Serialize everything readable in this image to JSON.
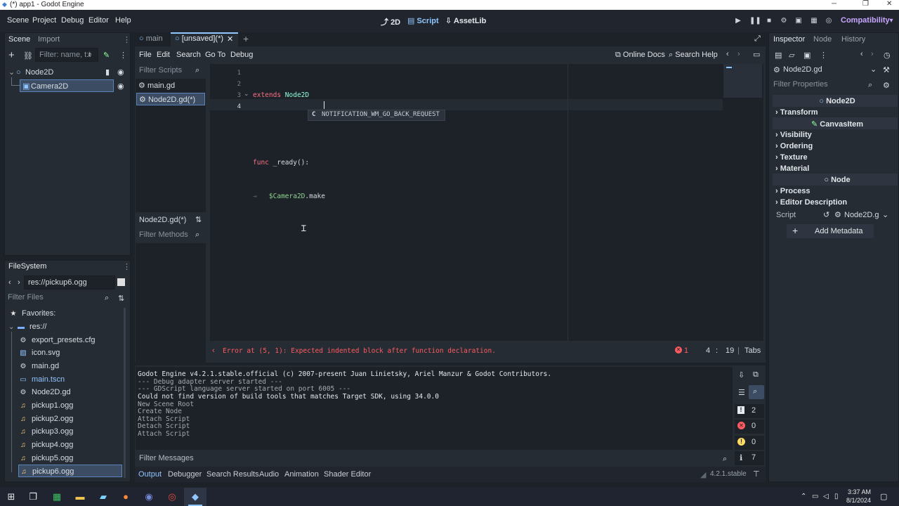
{
  "window": {
    "title": "(*) app1 - Godot Engine"
  },
  "menubar": {
    "menus": [
      "Scene",
      "Project",
      "Debug",
      "Editor",
      "Help"
    ],
    "workspaces": [
      "2D",
      "Script",
      "AssetLib"
    ],
    "renderer": "Compatibility"
  },
  "scene_dock": {
    "tabs": [
      "Scene",
      "Import"
    ],
    "filter_placeholder": "Filter: name, t:t",
    "nodes": [
      "Node2D",
      "Camera2D"
    ]
  },
  "filesystem": {
    "title": "FileSystem",
    "path": "res://pickup6.ogg",
    "filter_placeholder": "Filter Files",
    "favorites": "Favorites:",
    "root": "res://",
    "files": [
      "export_presets.cfg",
      "icon.svg",
      "main.gd",
      "main.tscn",
      "Node2D.gd",
      "pickup1.ogg",
      "pickup2.ogg",
      "pickup3.ogg",
      "pickup4.ogg",
      "pickup5.ogg",
      "pickup6.ogg"
    ]
  },
  "editor_tabs": [
    "main",
    "[unsaved](*)"
  ],
  "script_menu": [
    "File",
    "Edit",
    "Search",
    "Go To",
    "Debug"
  ],
  "script_toolbar": {
    "online_docs": "Online Docs",
    "search_help": "Search Help"
  },
  "script_list": {
    "filter_placeholder": "Filter Scripts",
    "scripts": [
      "main.gd",
      "Node2D.gd(*)"
    ],
    "current": "Node2D.gd(*)",
    "methods_placeholder": "Filter Methods"
  },
  "code": {
    "line_numbers": [
      "1",
      "2",
      "3",
      "4"
    ],
    "line1_kw": "extends",
    "line1_type": "Node2D",
    "line3_kw": "func",
    "line3_rest": "_ready():",
    "line4_indent": "⇥",
    "line4_node": "$Camera2D",
    "line4_rest": ".make",
    "autocomplete_icon": "C",
    "autocomplete": "NOTIFICATION_WM_GO_BACK_REQUEST"
  },
  "status": {
    "error": "Error at (5, 1): Expected indented block after function declaration.",
    "error_count": "1",
    "line": "4",
    "col": "19",
    "indent": "Tabs"
  },
  "console": {
    "lines": [
      "Godot Engine v4.2.1.stable.official (c) 2007-present Juan Linietsky, Ariel Manzur & Godot Contributors.",
      "--- Debug adapter server started ---",
      "--- GDScript language server started on port 6005 ---",
      "Could not find version of build tools that matches Target SDK, using 34.0.0",
      "New Scene Root",
      "Create Node",
      "Attach Script",
      "Detach Script",
      "Attach Script"
    ],
    "counts": {
      "messages": "2",
      "errors": "0",
      "warnings": "0",
      "info": "7"
    },
    "filter_placeholder": "Filter Messages"
  },
  "bottom_tabs": [
    "Output",
    "Debugger",
    "Search Results",
    "Audio",
    "Animation",
    "Shader Editor"
  ],
  "version": "4.2.1.stable",
  "inspector": {
    "tabs": [
      "Inspector",
      "Node",
      "History"
    ],
    "resource": "Node2D.gd",
    "filter_placeholder": "Filter Properties",
    "class1": "Node2D",
    "sec1": [
      "Transform"
    ],
    "class2": "CanvasItem",
    "sec2": [
      "Visibility",
      "Ordering",
      "Texture",
      "Material"
    ],
    "class3": "Node",
    "sec3": [
      "Process",
      "Editor Description"
    ],
    "script_label": "Script",
    "script_value": "Node2D.g",
    "add_metadata": "Add Metadata"
  },
  "taskbar": {
    "time": "3:37 AM",
    "date": "8/1/2024"
  },
  "colors": {
    "accent": "#8fc6ff",
    "error": "#ff5a5f",
    "keyword": "#ff7085",
    "type": "#8effda"
  }
}
